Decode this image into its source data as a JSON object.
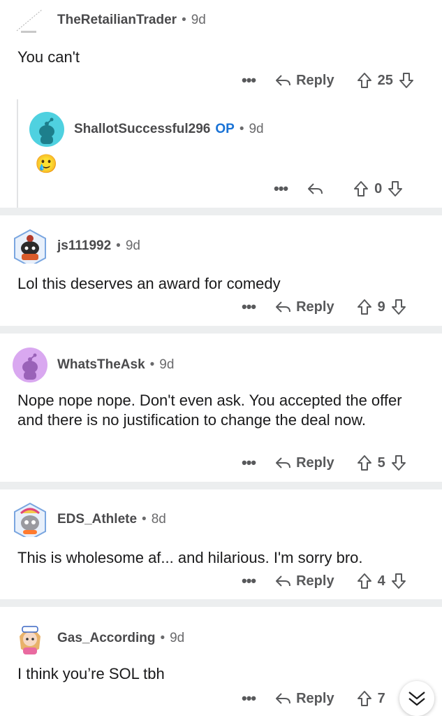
{
  "comments": [
    {
      "username": "TheRetailianTrader",
      "time": "9d",
      "body": "You can't",
      "reply_label": "Reply",
      "votes": "25"
    },
    {
      "username": "ShallotSuccessful296",
      "op_badge": "OP",
      "time": "9d",
      "body_emoji": "🥲",
      "votes": "0"
    },
    {
      "username": "js111992",
      "time": "9d",
      "body": "Lol this deserves an award for comedy",
      "reply_label": "Reply",
      "votes": "9"
    },
    {
      "username": "WhatsTheAsk",
      "time": "9d",
      "body": "Nope nope nope.  Don't even ask.  You accepted the offer and there is no justification to change the deal now.",
      "reply_label": "Reply",
      "votes": "5"
    },
    {
      "username": "EDS_Athlete",
      "time": "8d",
      "body": "This is wholesome af... and hilarious. I'm sorry bro.",
      "reply_label": "Reply",
      "votes": "4"
    },
    {
      "username": "Gas_According",
      "time": "9d",
      "body": "I think you’re SOL tbh",
      "reply_label": "Reply",
      "votes": "7"
    }
  ],
  "separator": "•",
  "more_label": "•••",
  "colors": {
    "op": "#1a73d6",
    "separator_band": "#eceeef",
    "text": "#1a1a1b",
    "meta": "#6a6a6c"
  }
}
